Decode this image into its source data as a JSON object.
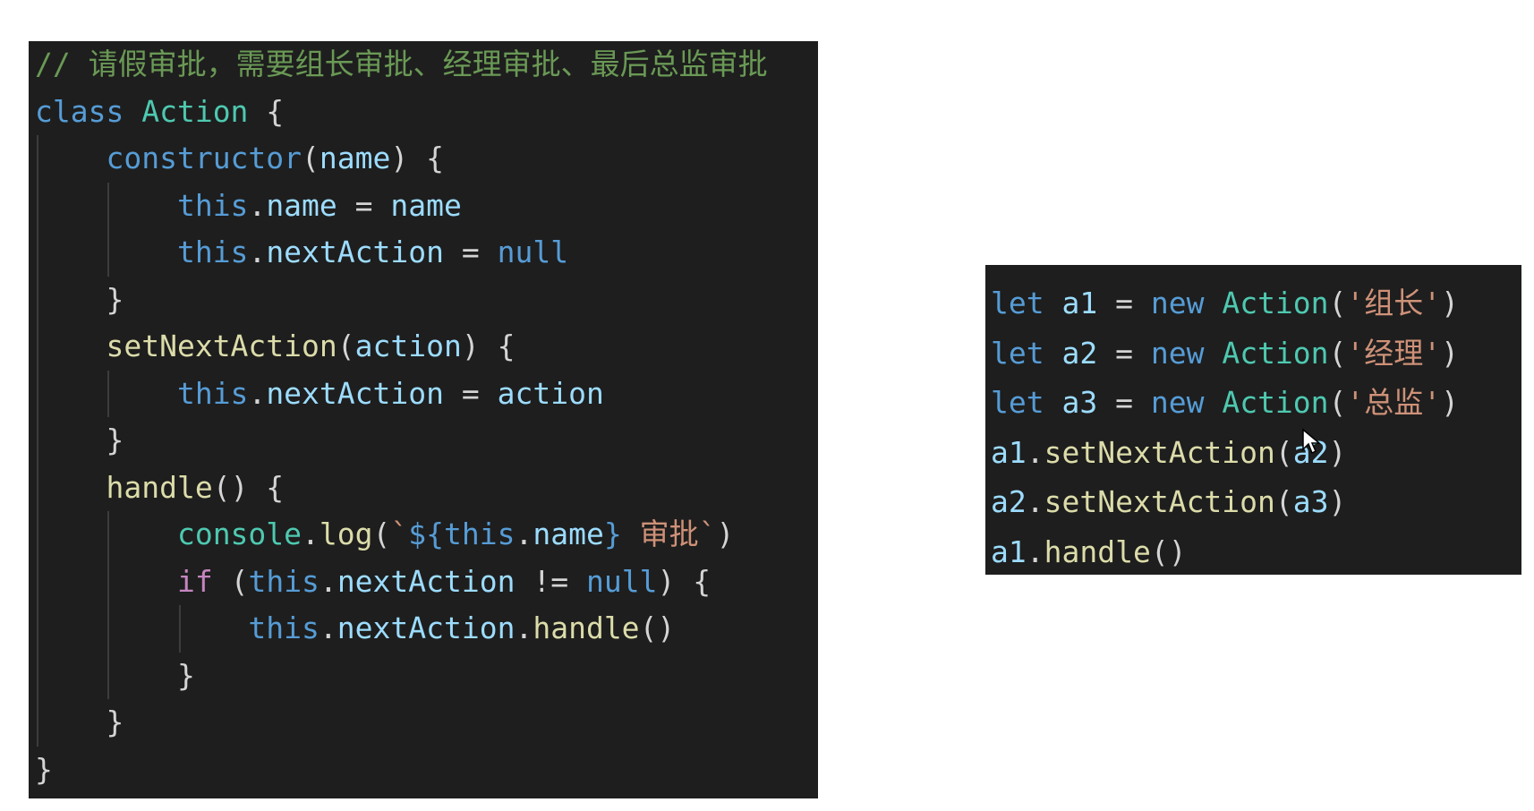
{
  "left_panel": {
    "lines": [
      {
        "indent": 0,
        "tokens": [
          {
            "t": "// 请假审批，需要组长审批、经理审批、最后总监审批",
            "c": "comment"
          }
        ]
      },
      {
        "indent": 0,
        "tokens": [
          {
            "t": "class ",
            "c": "kw"
          },
          {
            "t": "Action",
            "c": "type"
          },
          {
            "t": " {",
            "c": "punct"
          }
        ]
      },
      {
        "indent": 1,
        "tokens": [
          {
            "t": "constructor",
            "c": "kw"
          },
          {
            "t": "(",
            "c": "punct"
          },
          {
            "t": "name",
            "c": "var"
          },
          {
            "t": ") {",
            "c": "punct"
          }
        ]
      },
      {
        "indent": 2,
        "tokens": [
          {
            "t": "this",
            "c": "kw"
          },
          {
            "t": ".",
            "c": "punct"
          },
          {
            "t": "name",
            "c": "var"
          },
          {
            "t": " = ",
            "c": "punct"
          },
          {
            "t": "name",
            "c": "var"
          }
        ]
      },
      {
        "indent": 2,
        "tokens": [
          {
            "t": "this",
            "c": "kw"
          },
          {
            "t": ".",
            "c": "punct"
          },
          {
            "t": "nextAction",
            "c": "var"
          },
          {
            "t": " = ",
            "c": "punct"
          },
          {
            "t": "null",
            "c": "kw"
          }
        ]
      },
      {
        "indent": 1,
        "tokens": [
          {
            "t": "}",
            "c": "punct"
          }
        ]
      },
      {
        "indent": 1,
        "tokens": [
          {
            "t": "setNextAction",
            "c": "fn"
          },
          {
            "t": "(",
            "c": "punct"
          },
          {
            "t": "action",
            "c": "var"
          },
          {
            "t": ") {",
            "c": "punct"
          }
        ]
      },
      {
        "indent": 2,
        "tokens": [
          {
            "t": "this",
            "c": "kw"
          },
          {
            "t": ".",
            "c": "punct"
          },
          {
            "t": "nextAction",
            "c": "var"
          },
          {
            "t": " = ",
            "c": "punct"
          },
          {
            "t": "action",
            "c": "var"
          }
        ]
      },
      {
        "indent": 1,
        "tokens": [
          {
            "t": "}",
            "c": "punct"
          }
        ]
      },
      {
        "indent": 1,
        "tokens": [
          {
            "t": "handle",
            "c": "fn"
          },
          {
            "t": "() {",
            "c": "punct"
          }
        ]
      },
      {
        "indent": 2,
        "tokens": [
          {
            "t": "console",
            "c": "type"
          },
          {
            "t": ".",
            "c": "punct"
          },
          {
            "t": "log",
            "c": "fn"
          },
          {
            "t": "(",
            "c": "punct"
          },
          {
            "t": "`",
            "c": "str"
          },
          {
            "t": "${",
            "c": "kw"
          },
          {
            "t": "this",
            "c": "kw"
          },
          {
            "t": ".",
            "c": "punct"
          },
          {
            "t": "name",
            "c": "var"
          },
          {
            "t": "}",
            "c": "kw"
          },
          {
            "t": " 审批`",
            "c": "str"
          },
          {
            "t": ")",
            "c": "punct"
          }
        ]
      },
      {
        "indent": 2,
        "tokens": [
          {
            "t": "if",
            "c": "ctrl"
          },
          {
            "t": " (",
            "c": "punct"
          },
          {
            "t": "this",
            "c": "kw"
          },
          {
            "t": ".",
            "c": "punct"
          },
          {
            "t": "nextAction",
            "c": "var"
          },
          {
            "t": " != ",
            "c": "punct"
          },
          {
            "t": "null",
            "c": "kw"
          },
          {
            "t": ") {",
            "c": "punct"
          }
        ]
      },
      {
        "indent": 3,
        "tokens": [
          {
            "t": "this",
            "c": "kw"
          },
          {
            "t": ".",
            "c": "punct"
          },
          {
            "t": "nextAction",
            "c": "var"
          },
          {
            "t": ".",
            "c": "punct"
          },
          {
            "t": "handle",
            "c": "fn"
          },
          {
            "t": "()",
            "c": "punct"
          }
        ]
      },
      {
        "indent": 2,
        "tokens": [
          {
            "t": "}",
            "c": "punct"
          }
        ]
      },
      {
        "indent": 1,
        "tokens": [
          {
            "t": "}",
            "c": "punct"
          }
        ]
      },
      {
        "indent": 0,
        "tokens": [
          {
            "t": "}",
            "c": "punct"
          }
        ]
      }
    ]
  },
  "right_panel": {
    "lines": [
      {
        "indent": 0,
        "tokens": [
          {
            "t": "let ",
            "c": "kw"
          },
          {
            "t": "a1",
            "c": "var"
          },
          {
            "t": " = ",
            "c": "punct"
          },
          {
            "t": "new ",
            "c": "kw"
          },
          {
            "t": "Action",
            "c": "type"
          },
          {
            "t": "(",
            "c": "punct"
          },
          {
            "t": "'组长'",
            "c": "str"
          },
          {
            "t": ")",
            "c": "punct"
          }
        ]
      },
      {
        "indent": 0,
        "tokens": [
          {
            "t": "let ",
            "c": "kw"
          },
          {
            "t": "a2",
            "c": "var"
          },
          {
            "t": " = ",
            "c": "punct"
          },
          {
            "t": "new ",
            "c": "kw"
          },
          {
            "t": "Action",
            "c": "type"
          },
          {
            "t": "(",
            "c": "punct"
          },
          {
            "t": "'经理'",
            "c": "str"
          },
          {
            "t": ")",
            "c": "punct"
          }
        ]
      },
      {
        "indent": 0,
        "tokens": [
          {
            "t": "let ",
            "c": "kw"
          },
          {
            "t": "a3",
            "c": "var"
          },
          {
            "t": " = ",
            "c": "punct"
          },
          {
            "t": "new ",
            "c": "kw"
          },
          {
            "t": "Action",
            "c": "type"
          },
          {
            "t": "(",
            "c": "punct"
          },
          {
            "t": "'总监'",
            "c": "str"
          },
          {
            "t": ")",
            "c": "punct"
          }
        ]
      },
      {
        "indent": 0,
        "tokens": [
          {
            "t": "a1",
            "c": "var"
          },
          {
            "t": ".",
            "c": "punct"
          },
          {
            "t": "setNextAction",
            "c": "fn"
          },
          {
            "t": "(",
            "c": "punct"
          },
          {
            "t": "a2",
            "c": "var"
          },
          {
            "t": ")",
            "c": "punct"
          }
        ]
      },
      {
        "indent": 0,
        "tokens": [
          {
            "t": "a2",
            "c": "var"
          },
          {
            "t": ".",
            "c": "punct"
          },
          {
            "t": "setNextAction",
            "c": "fn"
          },
          {
            "t": "(",
            "c": "punct"
          },
          {
            "t": "a3",
            "c": "var"
          },
          {
            "t": ")",
            "c": "punct"
          }
        ]
      },
      {
        "indent": 0,
        "tokens": [
          {
            "t": "a1",
            "c": "var"
          },
          {
            "t": ".",
            "c": "punct"
          },
          {
            "t": "handle",
            "c": "fn"
          },
          {
            "t": "()",
            "c": "punct"
          }
        ]
      }
    ]
  },
  "theme": {
    "background": "#1e1e1e",
    "comment": "#6a9955",
    "keyword": "#569cd6",
    "control": "#c586c0",
    "type": "#4ec9b0",
    "function": "#dcdcaa",
    "variable": "#9cdcfe",
    "string": "#ce9178",
    "punctuation": "#d4d4d4"
  },
  "cursor": {
    "icon": "mouse-pointer-icon"
  }
}
